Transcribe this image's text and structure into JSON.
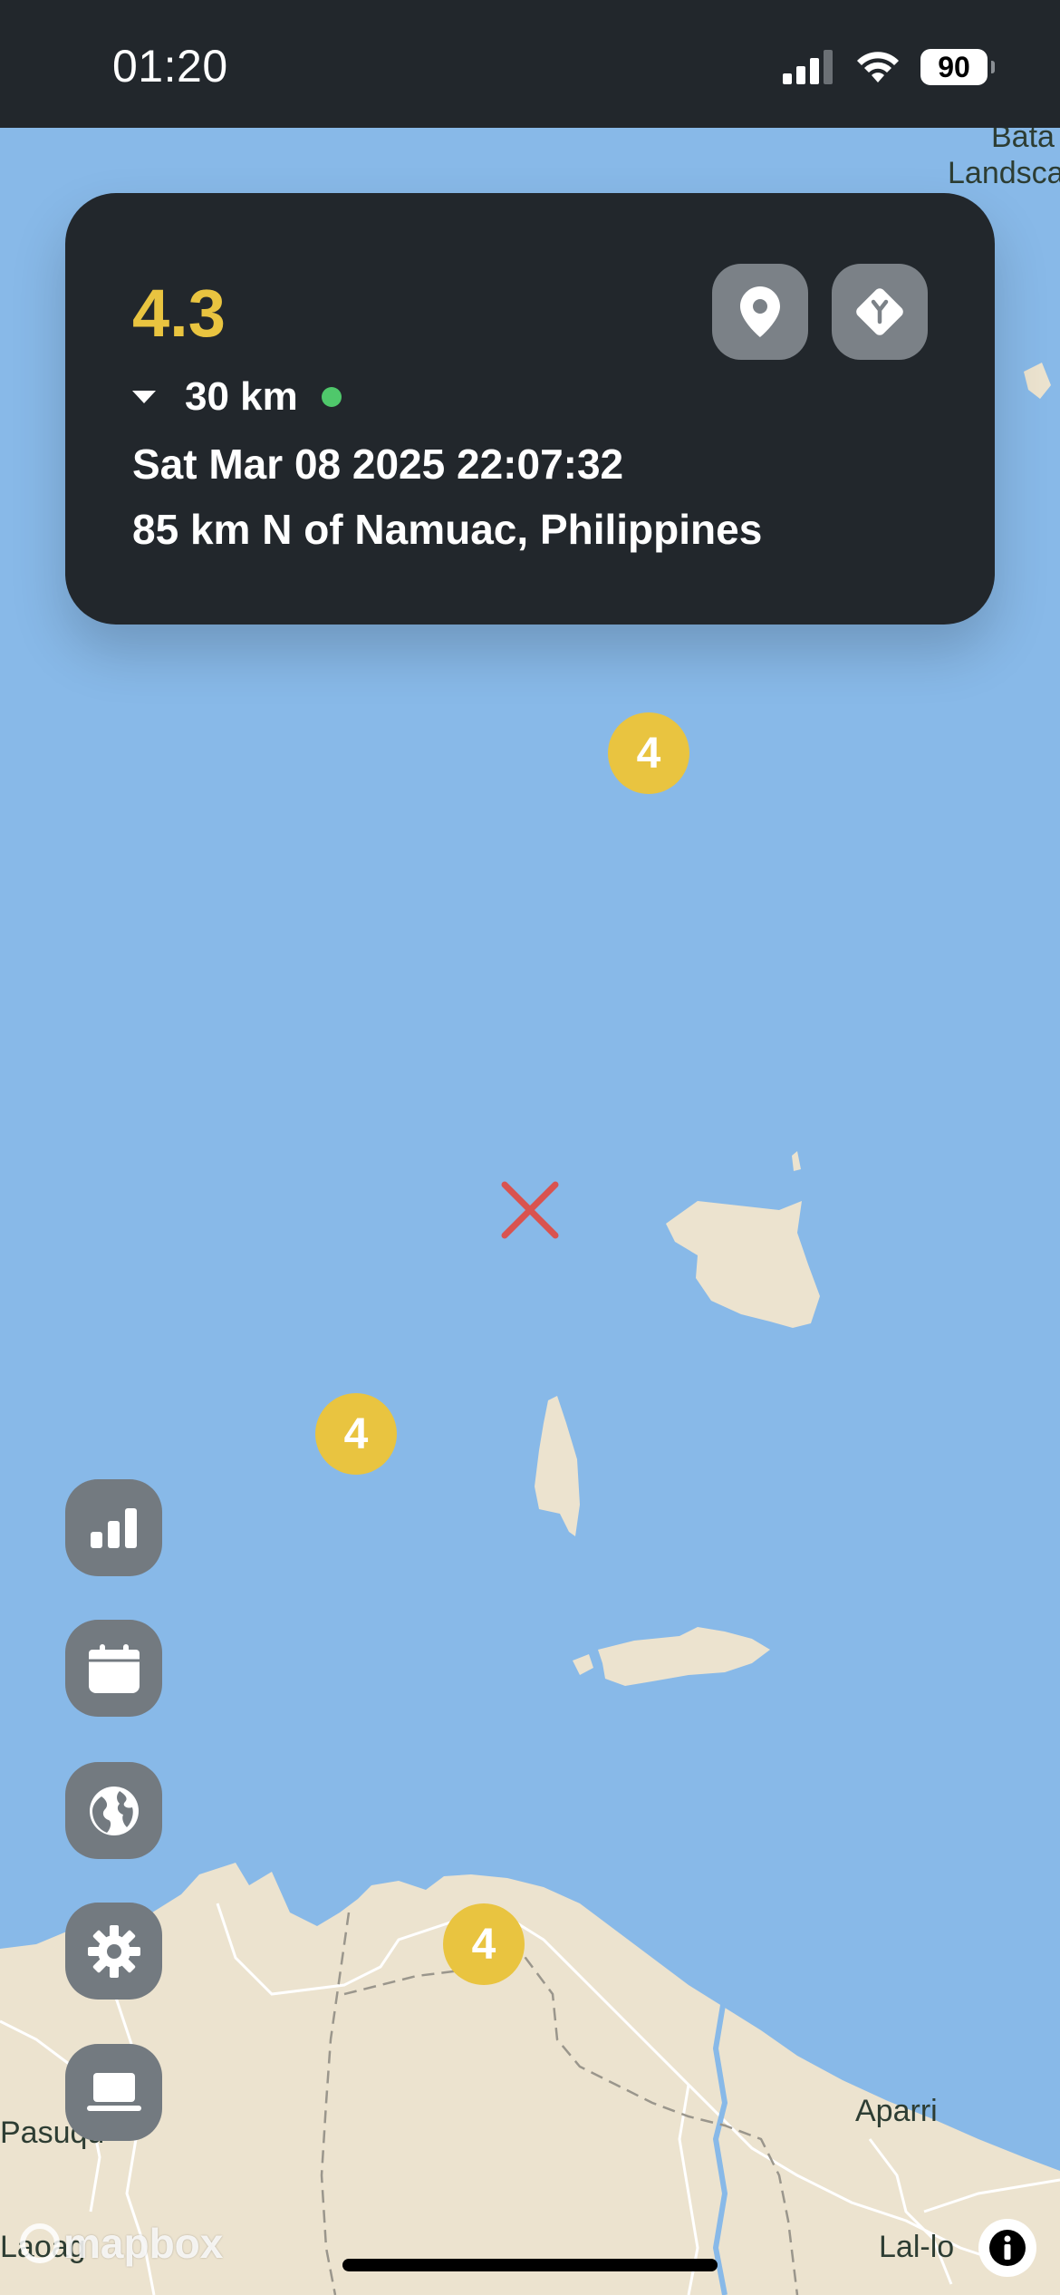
{
  "status_bar": {
    "time": "01:20",
    "battery": "90",
    "icons": [
      "cellular-signal-icon",
      "wifi-icon",
      "battery-icon"
    ]
  },
  "event_card": {
    "magnitude": "4.3",
    "depth": "30 km",
    "datetime": "Sat Mar 08 2025 22:07:32",
    "place": "85 km N of Namuac, Philippines",
    "actions": [
      "location-pin-icon",
      "directions-icon"
    ]
  },
  "clusters": [
    {
      "count": "4"
    },
    {
      "count": "4"
    },
    {
      "count": "4"
    }
  ],
  "map_labels": {
    "bata": "Bata",
    "landsca": "Landsca",
    "pasuq": "Pasuqu",
    "aparri": "Aparri",
    "lallo": "Lal-lo",
    "laoag": "Laoag"
  },
  "attribution": {
    "logo_text": "mapbox"
  },
  "side_menu": [
    "stats-icon",
    "calendar-icon",
    "globe-icon",
    "gear-icon",
    "laptop-icon"
  ],
  "colors": {
    "water": "#88b9e8",
    "land": "#ece3cf",
    "card_bg": "#22272c",
    "magnitude": "#e9c440",
    "cluster": "#e9c440",
    "epicenter": "#d9534f",
    "depth_dot": "#4fc86b"
  }
}
